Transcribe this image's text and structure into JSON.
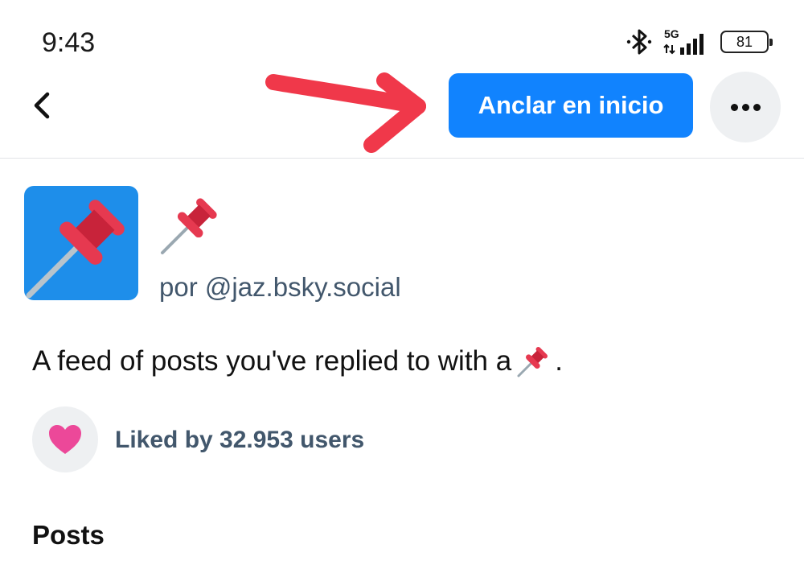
{
  "status_bar": {
    "time": "9:43",
    "network": "5G",
    "battery": "81",
    "icons": [
      "bluetooth-icon",
      "signal-icon",
      "battery-icon"
    ]
  },
  "header": {
    "back_icon": "chevron-left-icon",
    "pin_button_label": "Anclar en inicio",
    "more_icon": "ellipsis-icon",
    "accent_color": "#1183fe",
    "annotation_color": "#f0384a"
  },
  "feed": {
    "emoji_icon": "pushpin-icon",
    "creator": "por @jaz.bsky.social",
    "description": "A feed of posts you've replied to with a",
    "description_end": ".",
    "like_icon": "heart-icon",
    "like_color": "#ec4899",
    "likes_text": "Liked by 32.953 users"
  },
  "sections": {
    "posts_label": "Posts"
  }
}
